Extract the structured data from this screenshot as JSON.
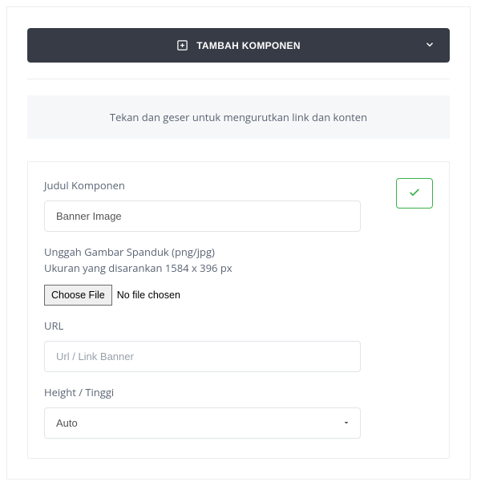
{
  "add_button": {
    "label": "TAMBAH KOMPONEN"
  },
  "info": {
    "text": "Tekan dan geser untuk mengurutkan link dan konten"
  },
  "form": {
    "title_label": "Judul Komponen",
    "title_value": "Banner Image",
    "upload_label": "Unggah Gambar Spanduk (png/jpg)",
    "upload_hint": "Ukuran yang disarankan 1584 x 396 px",
    "choose_file": "Choose File",
    "no_file": "No file chosen",
    "url_label": "URL",
    "url_placeholder": "Url / Link Banner",
    "height_label": "Height / Tinggi",
    "height_value": "Auto"
  }
}
